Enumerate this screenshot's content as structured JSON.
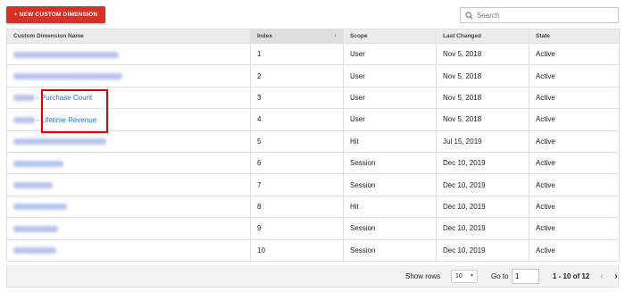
{
  "toolbar": {
    "new_button_label": "+ NEW CUSTOM DIMENSION",
    "search_placeholder": "Search"
  },
  "table": {
    "columns": [
      "Custom Dimension Name",
      "Index",
      "Scope",
      "Last Changed",
      "State"
    ],
    "sort_indicator": "↓",
    "rows": [
      {
        "name": "",
        "index": "1",
        "scope": "User",
        "last_changed": "Nov 5, 2018",
        "state": "Active"
      },
      {
        "name": "",
        "index": "2",
        "scope": "User",
        "last_changed": "Nov 5, 2018",
        "state": "Active"
      },
      {
        "name": "- Purchase Count",
        "index": "3",
        "scope": "User",
        "last_changed": "Nov 5, 2018",
        "state": "Active"
      },
      {
        "name": "- Lifetime Revenue",
        "index": "4",
        "scope": "User",
        "last_changed": "Nov 5, 2018",
        "state": "Active"
      },
      {
        "name": "",
        "index": "5",
        "scope": "Hit",
        "last_changed": "Jul 15, 2019",
        "state": "Active"
      },
      {
        "name": "",
        "index": "6",
        "scope": "Session",
        "last_changed": "Dec 10, 2019",
        "state": "Active"
      },
      {
        "name": "",
        "index": "7",
        "scope": "Session",
        "last_changed": "Dec 10, 2019",
        "state": "Active"
      },
      {
        "name": "",
        "index": "8",
        "scope": "Hit",
        "last_changed": "Dec 10, 2019",
        "state": "Active"
      },
      {
        "name": "",
        "index": "9",
        "scope": "Session",
        "last_changed": "Dec 10, 2019",
        "state": "Active"
      },
      {
        "name": "",
        "index": "10",
        "scope": "Session",
        "last_changed": "Dec 10, 2019",
        "state": "Active"
      }
    ]
  },
  "footer": {
    "show_rows_label": "Show rows",
    "rows_value": "10",
    "goto_label": "Go to",
    "goto_value": "1",
    "page_info": "1 - 10 of 12"
  },
  "colors": {
    "accent_button": "#d93025",
    "link": "#1a73e8",
    "highlight": "#e00000"
  }
}
